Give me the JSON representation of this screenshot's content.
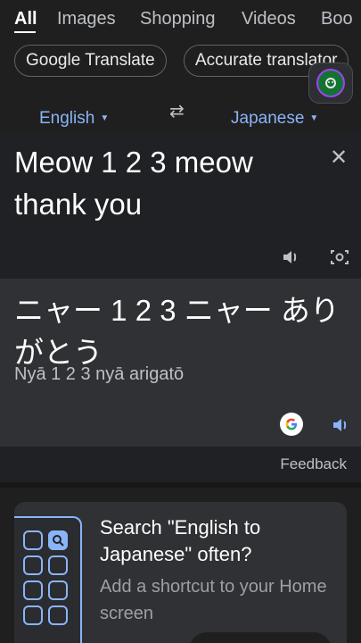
{
  "tabs": [
    "All",
    "Images",
    "Shopping",
    "Videos",
    "Boo"
  ],
  "chips": [
    "Google Translate",
    "Accurate translator"
  ],
  "languages": {
    "source": "English",
    "target": "Japanese"
  },
  "source_text": "Meow 1 2 3 meow thank you",
  "translated_text": "ニャー 1 2 3 ニャー ありがとう",
  "romanization": "Nyā 1 2 3 nyā arigatō",
  "feedback_label": "Feedback",
  "promo": {
    "title": "Search \"English to Japanese\" often?",
    "description": "Add a shortcut to your Home screen"
  },
  "icons": {
    "swap": "swap-arrows-icon",
    "close": "close-icon",
    "speaker": "speaker-icon",
    "camera": "camera-search-icon",
    "google": "google-logo-icon",
    "search": "search-icon"
  },
  "colors": {
    "accent": "#8ab4f8",
    "background": "#1f1f1f",
    "card_source": "#202124",
    "card_target": "#303134"
  }
}
